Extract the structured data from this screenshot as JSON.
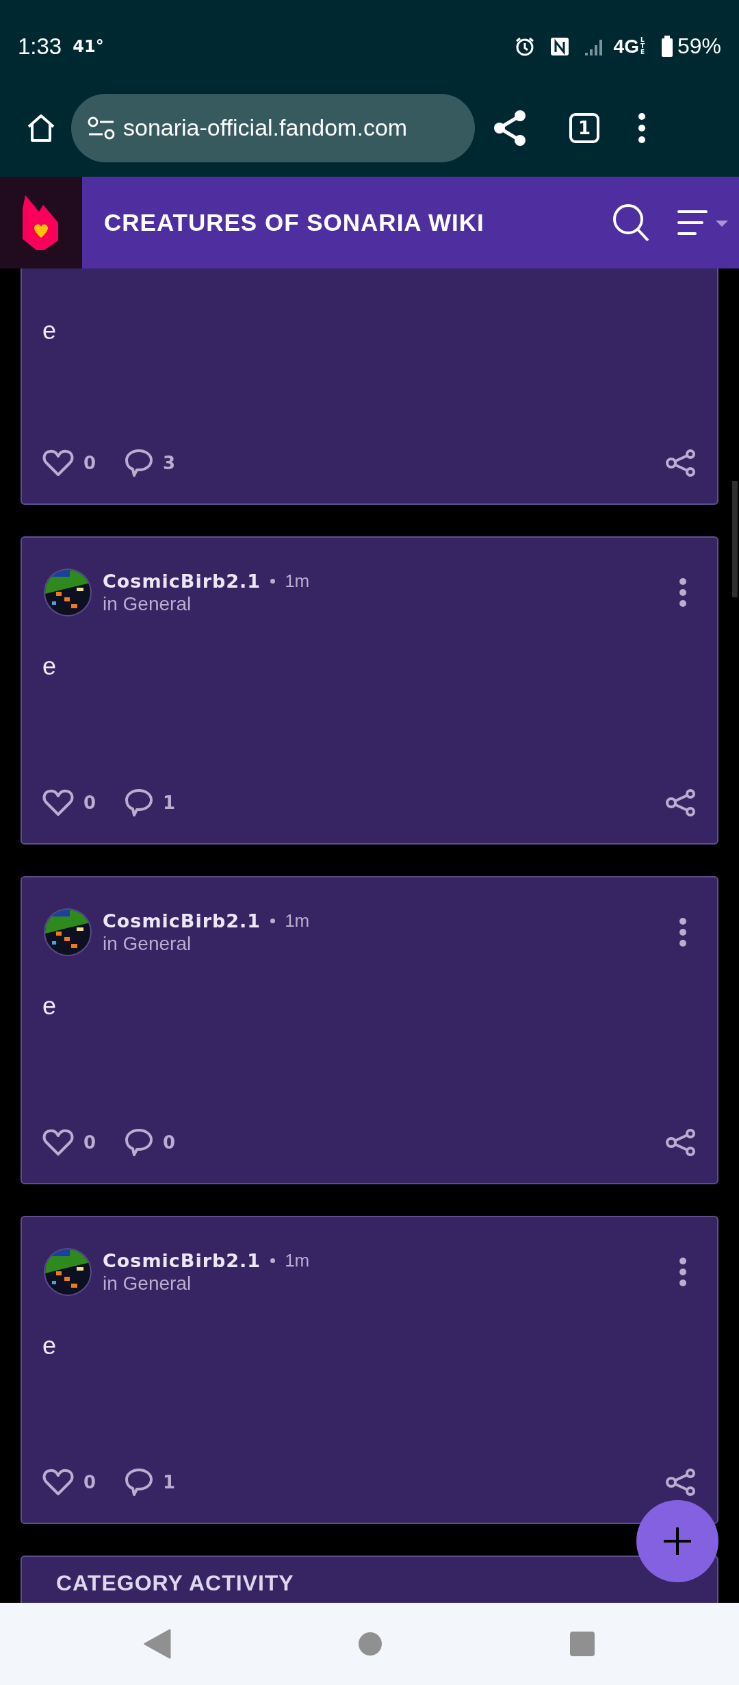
{
  "status_bar": {
    "time": "1:33",
    "temperature": "41°",
    "network": "4G",
    "network_sub": "LTE",
    "battery": "59%"
  },
  "browser": {
    "url": "sonaria-official.fandom.com",
    "tab_count": "1"
  },
  "wiki_header": {
    "title": "CREATURES OF SONARIA WIKI"
  },
  "posts": [
    {
      "kind": "continued",
      "body": "e",
      "likes": "0",
      "comments": "3"
    },
    {
      "kind": "full",
      "author": "CosmicBirb2.1",
      "time": "1m",
      "category": "in General",
      "body": "e",
      "likes": "0",
      "comments": "1"
    },
    {
      "kind": "full",
      "author": "CosmicBirb2.1",
      "time": "1m",
      "category": "in General",
      "body": "e",
      "likes": "0",
      "comments": "0"
    },
    {
      "kind": "full",
      "author": "CosmicBirb2.1",
      "time": "1m",
      "category": "in General",
      "body": "e",
      "likes": "0",
      "comments": "1"
    }
  ],
  "category_card": {
    "title": "CATEGORY ACTIVITY"
  }
}
